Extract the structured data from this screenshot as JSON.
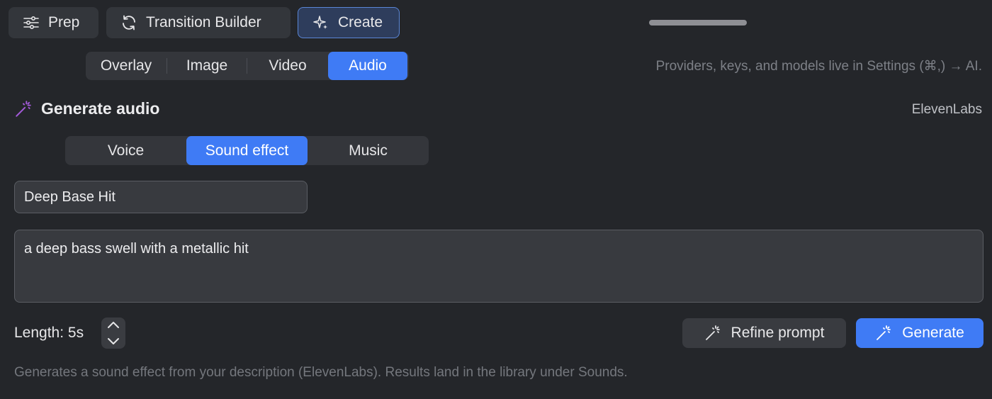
{
  "modes": [
    {
      "label": "Prep",
      "icon": "sliders-icon"
    },
    {
      "label": "Transition Builder",
      "icon": "refresh-icon"
    },
    {
      "label": "Create",
      "icon": "sparkle-icon",
      "active": true
    }
  ],
  "media_tabs": [
    {
      "label": "Overlay"
    },
    {
      "label": "Image"
    },
    {
      "label": "Video"
    },
    {
      "label": "Audio",
      "selected": true
    }
  ],
  "settings_hint": "Providers, keys, and models live in Settings (⌘,) → AI.",
  "section": {
    "title": "Generate audio",
    "icon": "magic-wand-icon",
    "provider": "ElevenLabs"
  },
  "audio_types": [
    {
      "label": "Voice"
    },
    {
      "label": "Sound effect",
      "selected": true
    },
    {
      "label": "Music"
    }
  ],
  "name_field": {
    "value": "Deep Base Hit"
  },
  "prompt_field": {
    "value": "a deep bass swell with a metallic hit"
  },
  "length": {
    "label": "Length: 5s",
    "seconds": 5
  },
  "actions": {
    "refine_label": "Refine prompt",
    "generate_label": "Generate"
  },
  "footer_hint": "Generates a sound effect from your description (ElevenLabs). Results land in the library under Sounds.",
  "colors": {
    "background": "#24262a",
    "accent": "#3f7bf5",
    "wand_purple": "#a35ad9"
  }
}
